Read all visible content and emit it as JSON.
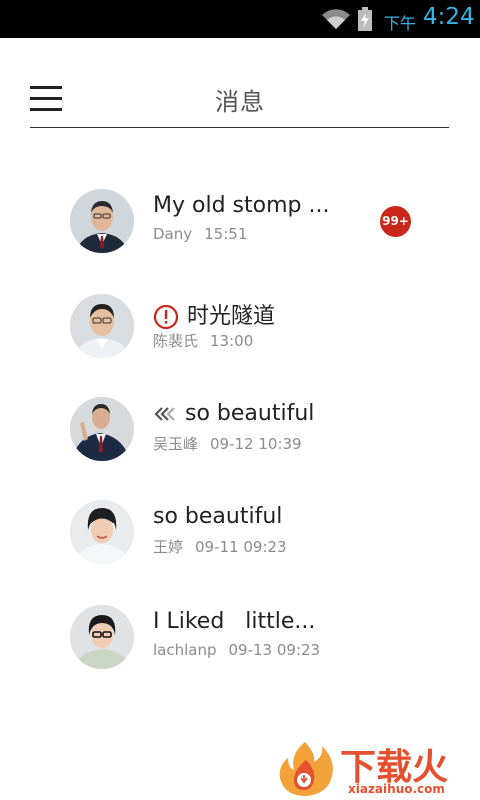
{
  "status_bar": {
    "ampm": "下午",
    "time": "4:24",
    "wifi_icon": "wifi-icon",
    "battery_icon": "battery-charging-icon",
    "accent": "#33b5e5"
  },
  "header": {
    "title": "消息",
    "menu_icon": "hamburger-menu-icon"
  },
  "messages": [
    {
      "title": "My old stomp ...",
      "sender": "Dany",
      "time": "15:51",
      "badge": "99+",
      "status_icon": null
    },
    {
      "title": "时光隧道",
      "sender": "陈裴氏",
      "time": "13:00",
      "badge": null,
      "status_icon": "alert-circle-icon"
    },
    {
      "title": "so beautiful",
      "sender": "吴玉峰",
      "time": "09-12 10:39",
      "badge": null,
      "status_icon": "double-chevron-left-icon"
    },
    {
      "title": "so beautiful",
      "sender": "王婷",
      "time": "09-11 09:23",
      "badge": null,
      "status_icon": null
    },
    {
      "title": "I Liked   little...",
      "sender": "lachlanp",
      "time": "09-13 09:23",
      "badge": null,
      "status_icon": null
    }
  ],
  "watermark": {
    "text": "下载火",
    "url": "xiazaihuo.com",
    "color": "#e5502e"
  },
  "colors": {
    "badge": "#c9271c",
    "alert": "#c9271c",
    "meta_text": "#8c8c8c"
  }
}
